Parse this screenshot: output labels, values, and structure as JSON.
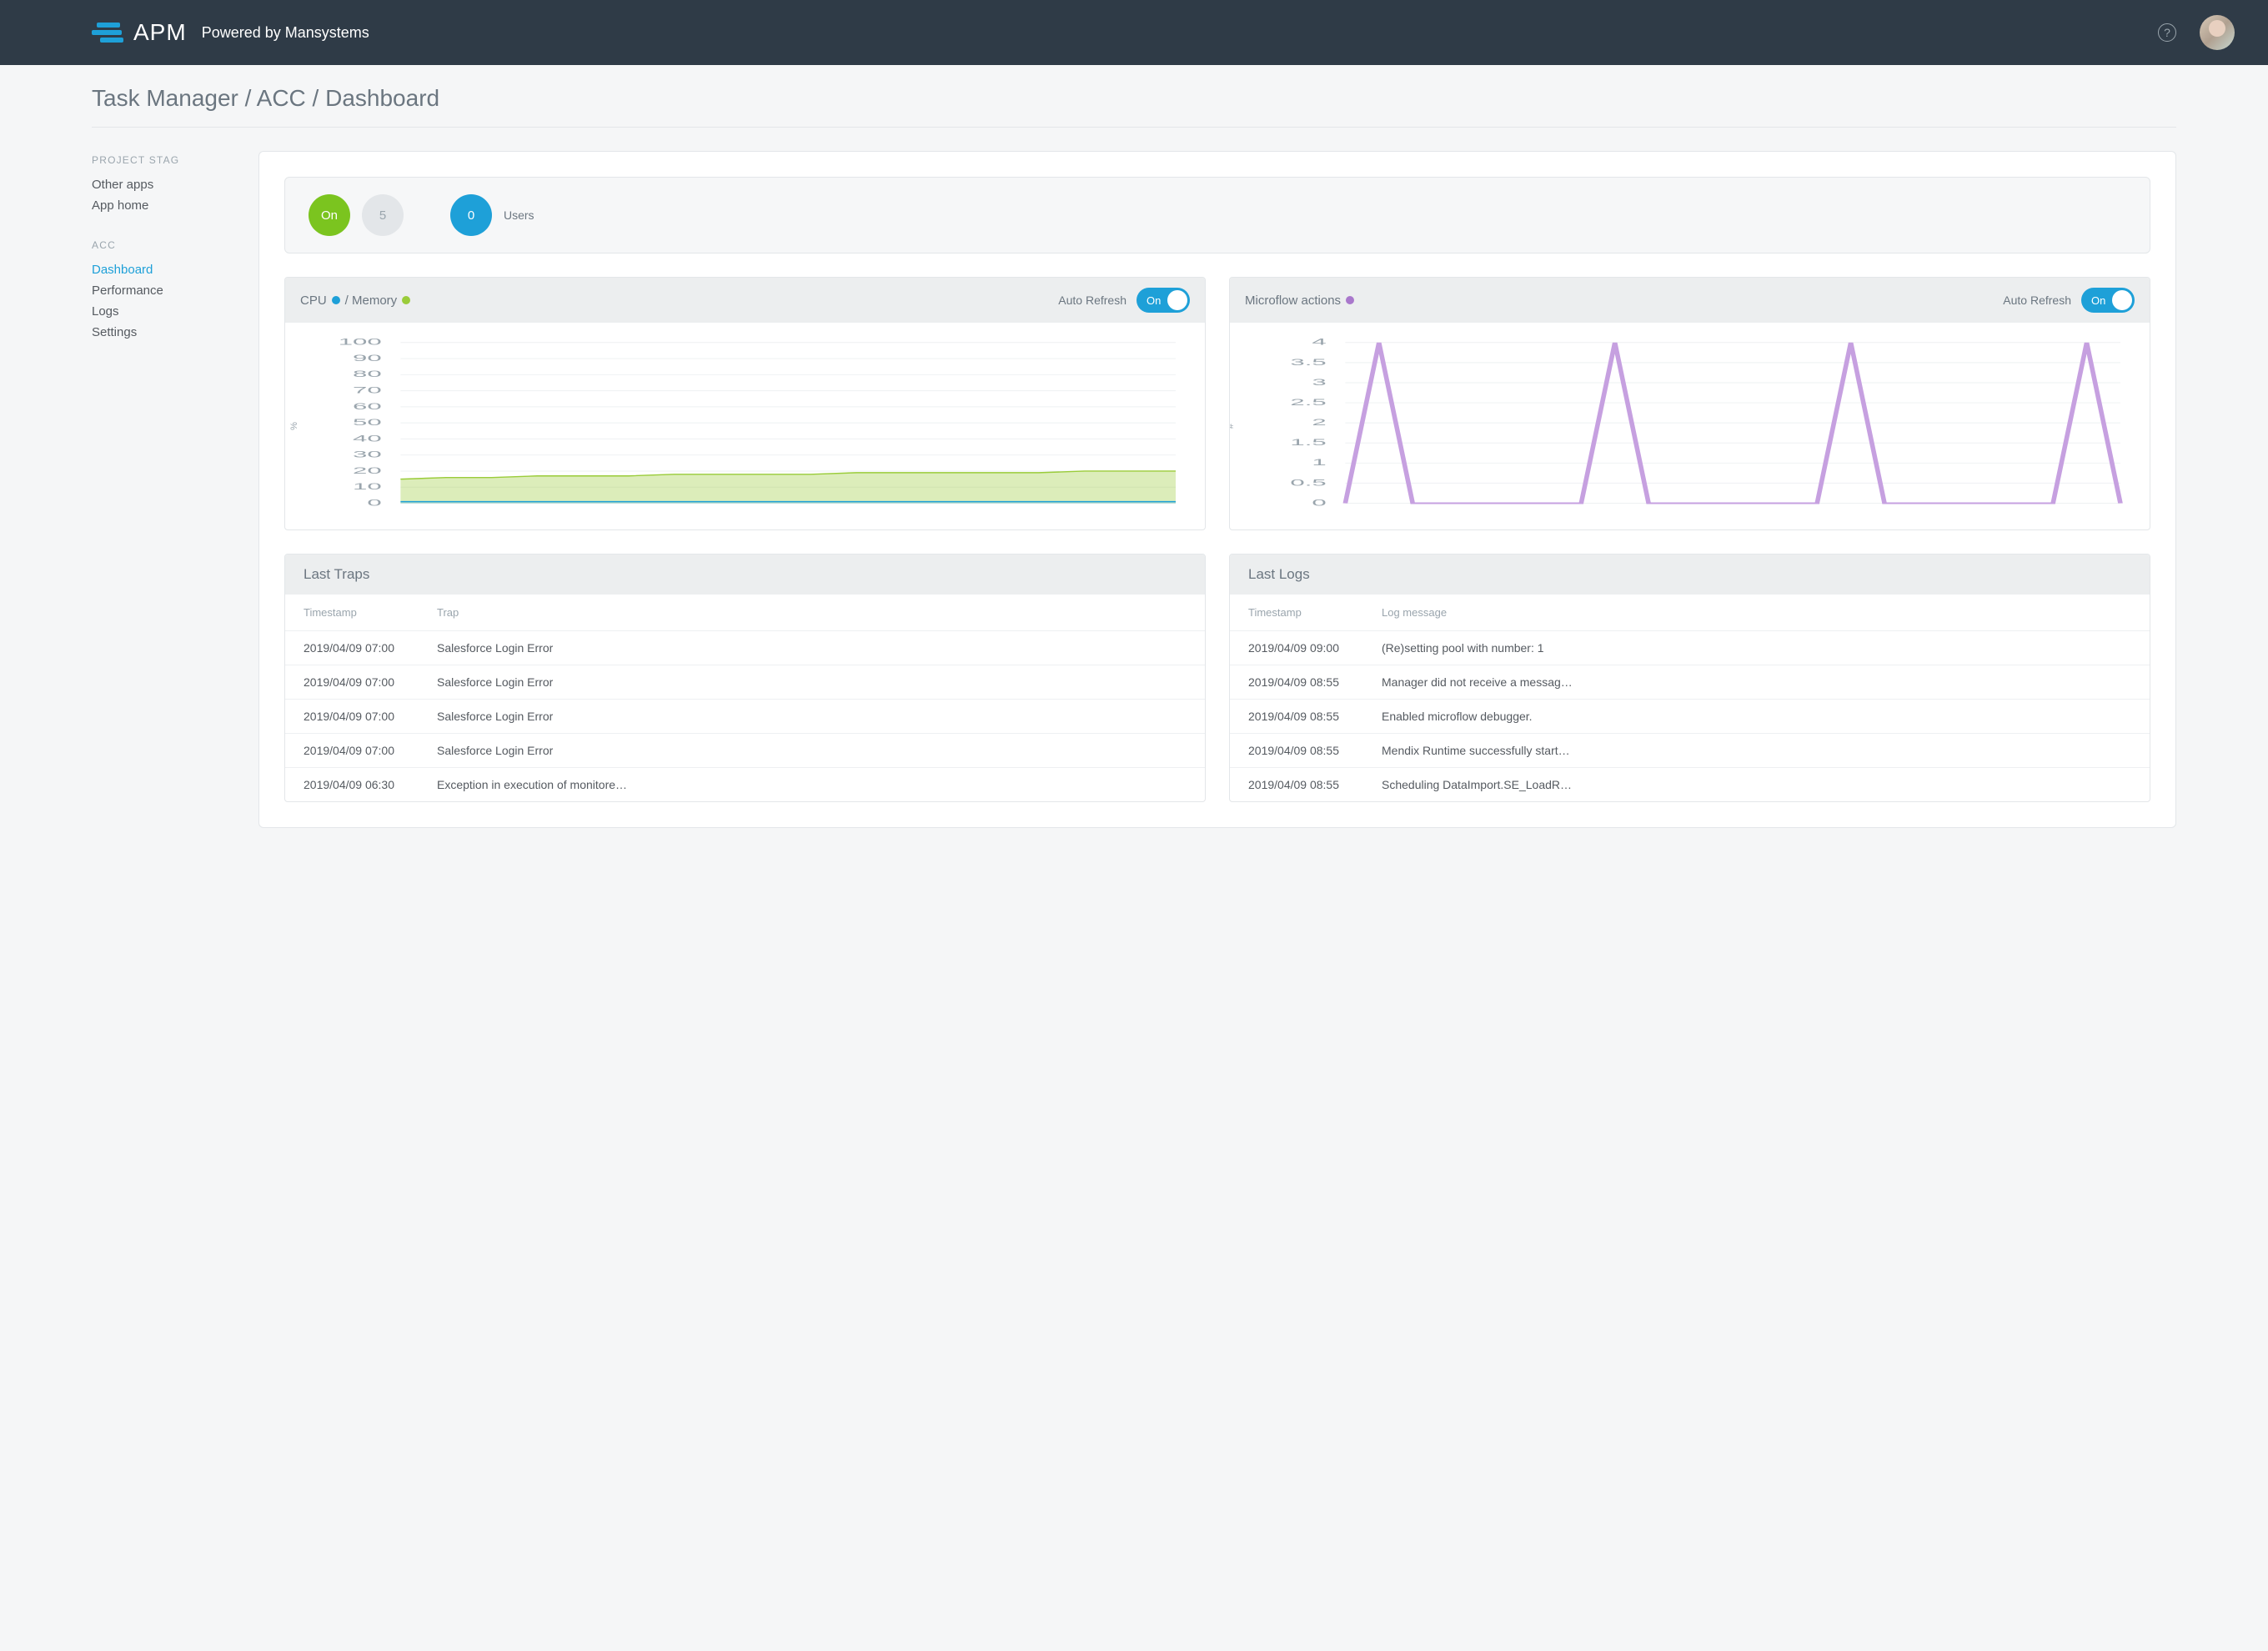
{
  "header": {
    "app_name": "APM",
    "subtitle": "Powered by Mansystems"
  },
  "breadcrumb": "Task Manager / ACC / Dashboard",
  "sidebar": {
    "section1_title": "PROJECT STAG",
    "section1_items": [
      "Other apps",
      "App home"
    ],
    "section2_title": "ACC",
    "section2_items": [
      "Dashboard",
      "Performance",
      "Logs",
      "Settings"
    ],
    "active": "Dashboard"
  },
  "status": {
    "on_label": "On",
    "count": "5",
    "users_count": "0",
    "users_label": "Users"
  },
  "panel_cpu": {
    "title_cpu": "CPU",
    "title_mem": "/ Memory",
    "auto_refresh_label": "Auto Refresh",
    "toggle_text": "On"
  },
  "panel_micro": {
    "title": "Microflow actions",
    "auto_refresh_label": "Auto Refresh",
    "toggle_text": "On"
  },
  "chart_data": [
    {
      "type": "area",
      "title": "CPU / Memory",
      "ylabel": "%",
      "ylim": [
        0,
        100
      ],
      "yticks": [
        0,
        10,
        20,
        30,
        40,
        50,
        60,
        70,
        80,
        90,
        100
      ],
      "series": [
        {
          "name": "Memory",
          "color": "#9acc3a",
          "values": [
            15,
            16,
            16,
            17,
            17,
            17,
            18,
            18,
            18,
            18,
            19,
            19,
            19,
            19,
            19,
            20,
            20,
            20
          ]
        },
        {
          "name": "CPU",
          "color": "#1ea0d8",
          "values": [
            1,
            1,
            1,
            1,
            1,
            1,
            1,
            1,
            1,
            1,
            1,
            1,
            1,
            1,
            1,
            1,
            1,
            1
          ]
        }
      ]
    },
    {
      "type": "line",
      "title": "Microflow actions",
      "ylabel": "#",
      "ylim": [
        0,
        4
      ],
      "yticks": [
        0,
        0.5,
        1,
        1.5,
        2,
        2.5,
        3,
        3.5,
        4
      ],
      "series": [
        {
          "name": "Microflow actions",
          "color": "#c6a0e0",
          "values": [
            0,
            4,
            0,
            0,
            0,
            0,
            0,
            0,
            4,
            0,
            0,
            0,
            0,
            0,
            0,
            4,
            0,
            0,
            0,
            0,
            0,
            0,
            4,
            0
          ]
        }
      ]
    }
  ],
  "traps": {
    "title": "Last Traps",
    "col_ts": "Timestamp",
    "col_msg": "Trap",
    "rows": [
      {
        "ts": "2019/04/09 07:00",
        "msg": "Salesforce Login Error"
      },
      {
        "ts": "2019/04/09 07:00",
        "msg": "Salesforce Login Error"
      },
      {
        "ts": "2019/04/09 07:00",
        "msg": "Salesforce Login Error"
      },
      {
        "ts": "2019/04/09 07:00",
        "msg": "Salesforce Login Error"
      },
      {
        "ts": "2019/04/09 06:30",
        "msg": "Exception in execution of monitore…"
      }
    ]
  },
  "logs": {
    "title": "Last Logs",
    "col_ts": "Timestamp",
    "col_msg": "Log message",
    "rows": [
      {
        "ts": "2019/04/09 09:00",
        "msg": "(Re)setting pool with number: 1"
      },
      {
        "ts": "2019/04/09 08:55",
        "msg": "Manager did not receive a messag…"
      },
      {
        "ts": "2019/04/09 08:55",
        "msg": "Enabled microflow debugger."
      },
      {
        "ts": "2019/04/09 08:55",
        "msg": "Mendix Runtime successfully start…"
      },
      {
        "ts": "2019/04/09 08:55",
        "msg": "Scheduling DataImport.SE_LoadR…"
      }
    ]
  }
}
